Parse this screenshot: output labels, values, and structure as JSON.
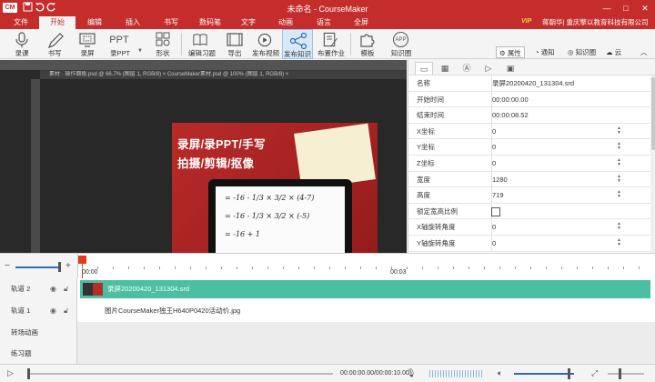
{
  "app": {
    "title": "未命名 - CourseMaker",
    "logo_text": "CM"
  },
  "quick_access": [
    "save-icon",
    "undo-icon",
    "redo-icon"
  ],
  "window_controls": [
    "minimize-icon",
    "maximize-icon",
    "close-icon"
  ],
  "menus": [
    {
      "label": "文件",
      "active": false
    },
    {
      "label": "开始",
      "active": true
    },
    {
      "label": "编辑",
      "active": false
    },
    {
      "label": "插入",
      "active": false
    },
    {
      "label": "书写",
      "active": false
    },
    {
      "label": "数码笔",
      "active": false
    },
    {
      "label": "文字",
      "active": false
    },
    {
      "label": "动画",
      "active": false
    },
    {
      "label": "语言",
      "active": false
    },
    {
      "label": "全屏",
      "active": false
    }
  ],
  "user": {
    "vip": "VIP",
    "name": "蒋朝华| 重庆擎以教育科技有限公司"
  },
  "ribbon": {
    "tools": [
      "录课",
      "书写",
      "录屏",
      "录PPT",
      "形状",
      "编辑习题",
      "导出",
      "发布视频",
      "发布知识",
      "布置作业",
      "模板",
      "知识圈"
    ],
    "ppt_icon_text": "PPT",
    "app_icon_text": "APP",
    "right_tabs": [
      "属性",
      "通知",
      "知识圈",
      "云"
    ]
  },
  "canvas": {
    "ps_tab_text": "素材 · 操作面板.psd @ 66.7% (图层 1, RGB/8) ×   CourseMaker素材.psd @ 100% (图层 1, RGB/8) ×",
    "promo_line1": "录屏/录PPT/手写",
    "promo_line2": "拍摄/剪辑/抠像",
    "math_lines": [
      "= -16 - 1/3 × 3/2 × (4-7)",
      "= -16 - 1/3 × 3/2 × (-5)",
      "= -16 + 1"
    ]
  },
  "properties": {
    "tabs": [
      "attributes-icon",
      "grid-icon",
      "text-icon",
      "play-icon",
      "image-icon"
    ],
    "rows": [
      {
        "key": "名称",
        "value": "录屏20200420_131304.srd",
        "spin": false,
        "checkbox": false
      },
      {
        "key": "开始时间",
        "value": "00:00:00.00",
        "spin": false,
        "checkbox": false
      },
      {
        "key": "结束时间",
        "value": "00:00:08.52",
        "spin": false,
        "checkbox": false
      },
      {
        "key": "X坐标",
        "value": "0",
        "spin": true,
        "checkbox": false
      },
      {
        "key": "Y坐标",
        "value": "0",
        "spin": true,
        "checkbox": false
      },
      {
        "key": "Z坐标",
        "value": "0",
        "spin": true,
        "checkbox": false
      },
      {
        "key": "宽度",
        "value": "1280",
        "spin": true,
        "checkbox": false
      },
      {
        "key": "高度",
        "value": "719",
        "spin": true,
        "checkbox": false
      },
      {
        "key": "锁定宽高比例",
        "value": "",
        "spin": false,
        "checkbox": true
      },
      {
        "key": "X轴旋转角度",
        "value": "0",
        "spin": true,
        "checkbox": false
      },
      {
        "key": "Y轴旋转角度",
        "value": "0",
        "spin": true,
        "checkbox": false
      }
    ]
  },
  "timeline": {
    "zoom_minus": "−",
    "zoom_plus": "+",
    "ruler_start": "00:00",
    "ruler_mid": "00:03",
    "tracks": [
      {
        "name": "轨道 2",
        "clip": "录屏20200420_131304.srd",
        "type": "video"
      },
      {
        "name": "轨道 1",
        "clip": "图片CourseMaker独王H640P0420活动价.jpg",
        "type": "image"
      },
      {
        "name": "转场动画",
        "clip": "",
        "type": "empty"
      },
      {
        "name": "练习题",
        "clip": "",
        "type": "empty"
      }
    ]
  },
  "player": {
    "time": "00:00:00.00/00:00:10.00"
  }
}
